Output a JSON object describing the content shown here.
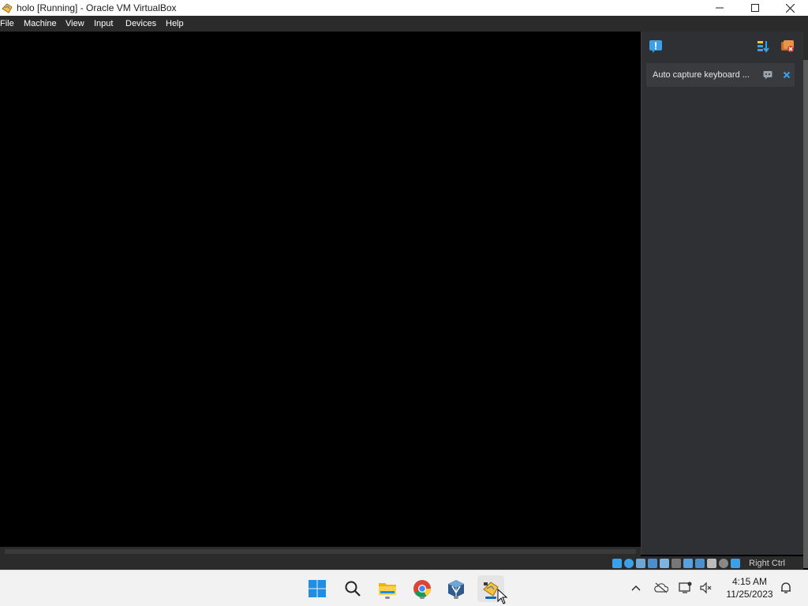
{
  "window": {
    "title": "holo [Running] - Oracle VM VirtualBox",
    "app_icon": "virtualbox-icon",
    "controls": {
      "minimize": "minimize-icon",
      "maximize": "maximize-icon",
      "close": "close-icon"
    }
  },
  "menubar": {
    "items": [
      {
        "label": "File"
      },
      {
        "label": "Machine"
      },
      {
        "label": "View"
      },
      {
        "label": "Input"
      },
      {
        "label": "Devices"
      },
      {
        "label": "Help"
      }
    ]
  },
  "notification_center": {
    "toolbar_icons": [
      "notification-center-icon",
      "sort-icon",
      "dismiss-all-icon"
    ],
    "messages": [
      {
        "text": "Auto capture keyboard ..."
      }
    ]
  },
  "statusbar": {
    "host_key": "Right Ctrl"
  },
  "taskbar": {
    "apps": [
      {
        "name": "Start",
        "icon": "windows-start-icon"
      },
      {
        "name": "Search",
        "icon": "search-icon"
      },
      {
        "name": "File Explorer",
        "icon": "folder-icon"
      },
      {
        "name": "Google Chrome",
        "icon": "chrome-icon"
      },
      {
        "name": "VirtualBox Manager",
        "icon": "virtualbox-manager-icon"
      },
      {
        "name": "holo [Running]",
        "icon": "virtualbox-vm-icon"
      }
    ],
    "clock": {
      "time": "4:15 AM",
      "date": "11/25/2023"
    }
  },
  "colors": {
    "menubar_bg": "#2b2b2b",
    "panel_bg": "#2f3033",
    "accent_blue": "#0067c0",
    "notif_accent": "#3aa0e8"
  }
}
